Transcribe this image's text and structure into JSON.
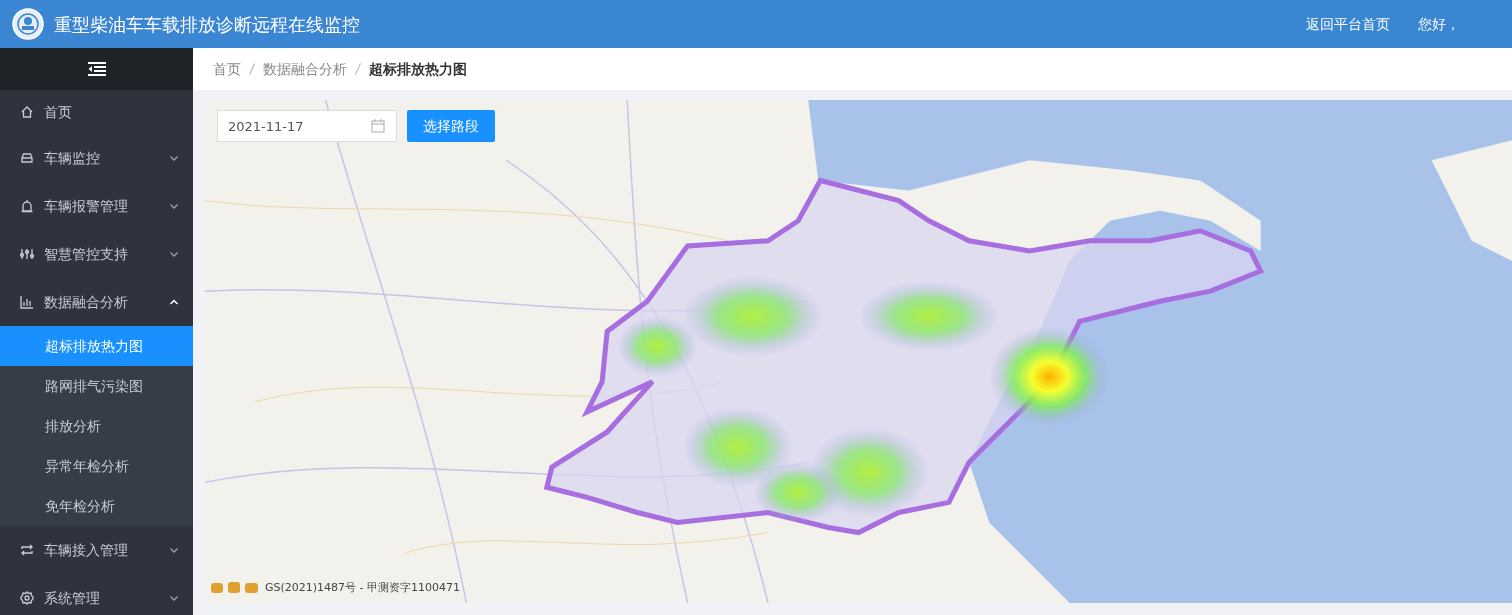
{
  "header": {
    "title": "重型柴油车车载排放诊断远程在线监控",
    "links": [
      "返回平台首页"
    ],
    "greeting": "您好，"
  },
  "sidebar": {
    "items": [
      {
        "label": "首页",
        "expandable": false,
        "selected": false
      },
      {
        "label": "车辆监控",
        "expandable": true,
        "expanded": false,
        "selected": false
      },
      {
        "label": "车辆报警管理",
        "expandable": true,
        "expanded": false,
        "selected": false
      },
      {
        "label": "智慧管控支持",
        "expandable": true,
        "expanded": false,
        "selected": false
      },
      {
        "label": "数据融合分析",
        "expandable": true,
        "expanded": true,
        "selected": false,
        "children": [
          {
            "label": "超标排放热力图",
            "selected": true
          },
          {
            "label": "路网排气污染图",
            "selected": false
          },
          {
            "label": "排放分析",
            "selected": false
          },
          {
            "label": "异常年检分析",
            "selected": false
          },
          {
            "label": "免年检分析",
            "selected": false
          }
        ]
      },
      {
        "label": "车辆接入管理",
        "expandable": true,
        "expanded": false,
        "selected": false
      },
      {
        "label": "系统管理",
        "expandable": true,
        "expanded": false,
        "selected": false
      }
    ]
  },
  "breadcrumb": [
    "首页",
    "数据融合分析",
    "超标排放热力图"
  ],
  "toolbar": {
    "date": "2021-11-17",
    "button": "选择路段"
  },
  "map": {
    "attribution": "GS(2021)1487号 - 甲测资字1100471"
  }
}
